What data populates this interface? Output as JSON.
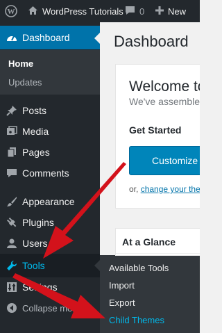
{
  "adminbar": {
    "site_name": "WordPress Tutorials",
    "comments_count": "0",
    "new_label": "New"
  },
  "menu": {
    "dashboard": "Dashboard",
    "home": "Home",
    "updates": "Updates",
    "posts": "Posts",
    "media": "Media",
    "pages": "Pages",
    "comments": "Comments",
    "appearance": "Appearance",
    "plugins": "Plugins",
    "users": "Users",
    "tools": "Tools",
    "settings": "Settings",
    "collapse": "Collapse menu"
  },
  "tools_flyout": {
    "items": [
      "Available Tools",
      "Import",
      "Export",
      "Child Themes"
    ],
    "active": "Child Themes"
  },
  "main": {
    "title": "Dashboard",
    "welcome_heading": "Welcome to",
    "welcome_sub": "We've assembled",
    "get_started": "Get Started",
    "customize_button": "Customize Yo",
    "or_text": "or,",
    "change_theme_link": "change your the",
    "glance_heading": "At a Glance"
  },
  "colors": {
    "adminbar_bg": "#23282d",
    "menu_active": "#0073aa",
    "link_highlight": "#00b9eb",
    "annotation_arrow": "#d3121b"
  }
}
